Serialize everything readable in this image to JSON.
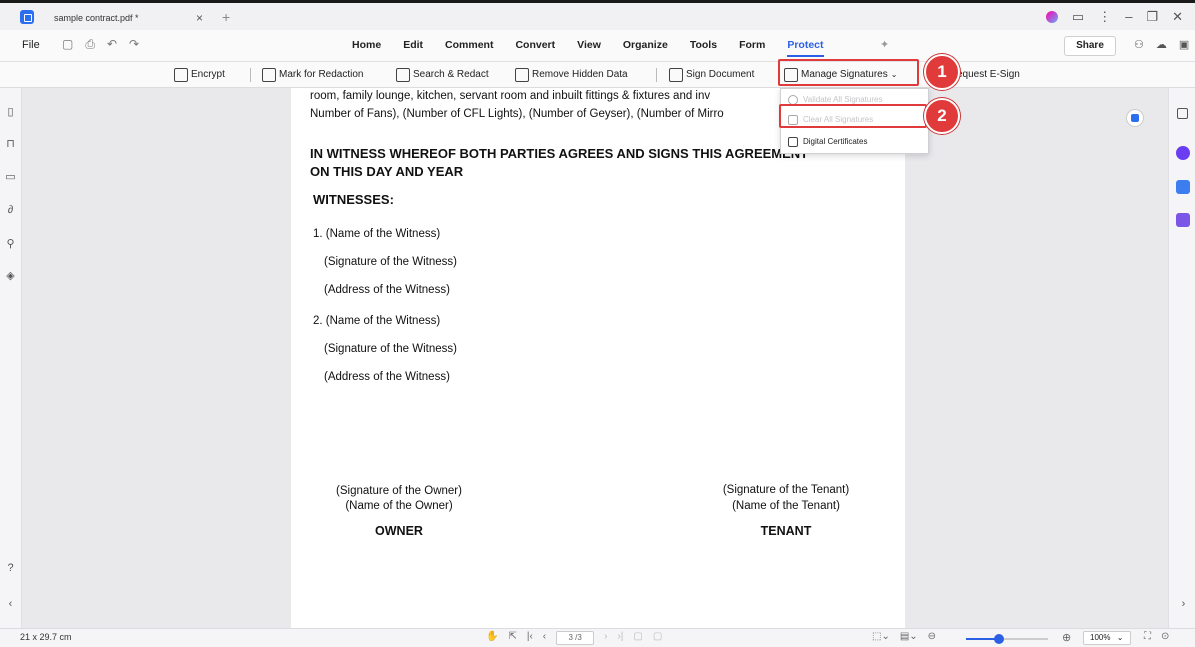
{
  "window": {
    "tab_title": "sample contract.pdf *",
    "tab_close": "×",
    "tab_add": "+"
  },
  "menubar": {
    "file": "File",
    "items": [
      "Home",
      "Edit",
      "Comment",
      "Convert",
      "View",
      "Organize",
      "Tools",
      "Form",
      "Protect"
    ],
    "active": "Protect",
    "share": "Share"
  },
  "toolbar": {
    "encrypt": "Encrypt",
    "mark_redaction": "Mark for Redaction",
    "search_redact": "Search & Redact",
    "remove_hidden": "Remove Hidden Data",
    "sign_document": "Sign Document",
    "manage_signatures": "Manage Signatures",
    "request_esign": "equest E-Sign"
  },
  "dropdown": {
    "items": [
      {
        "label": "Validate All Signatures",
        "enabled": false,
        "icon": "validate-icon"
      },
      {
        "label": "Clear All Signatures",
        "enabled": false,
        "icon": "clear-icon"
      },
      {
        "label": "Digital Certificates",
        "enabled": true,
        "icon": "certificate-icon"
      }
    ]
  },
  "callouts": [
    "1",
    "2"
  ],
  "document": {
    "line1": "room, family lounge, kitchen, servant room and inbuilt fittings & fixtures and inv",
    "line2": "Number of Fans), (Number of CFL Lights), (Number of Geyser), (Number of Mirro",
    "heading1": "IN WITNESS WHEREOF BOTH PARTIES AGREES AND SIGNS THIS AGREEMENT",
    "heading2": "ON THIS DAY AND YEAR",
    "witnesses_title": "WITNESSES:",
    "witness1": {
      "name": "1. (Name of the Witness)",
      "signature": "(Signature of the Witness)",
      "address": "(Address of the Witness)"
    },
    "witness2": {
      "name": "2. (Name of the Witness)",
      "signature": "(Signature of the Witness)",
      "address": "(Address of the Witness)"
    },
    "owner": {
      "signature": "(Signature of the Owner)",
      "name": "(Name of the Owner)",
      "title": "OWNER"
    },
    "tenant": {
      "signature": "(Signature of the Tenant)",
      "name": "(Name of the Tenant)",
      "title": "TENANT"
    }
  },
  "statusbar": {
    "page_size": "21 x 29.7 cm",
    "page_indicator": "3 /3",
    "zoom": "100%",
    "zoom_level": 0.4
  },
  "colors": {
    "accent": "#2b5fe6",
    "callout": "#e03a3a"
  }
}
